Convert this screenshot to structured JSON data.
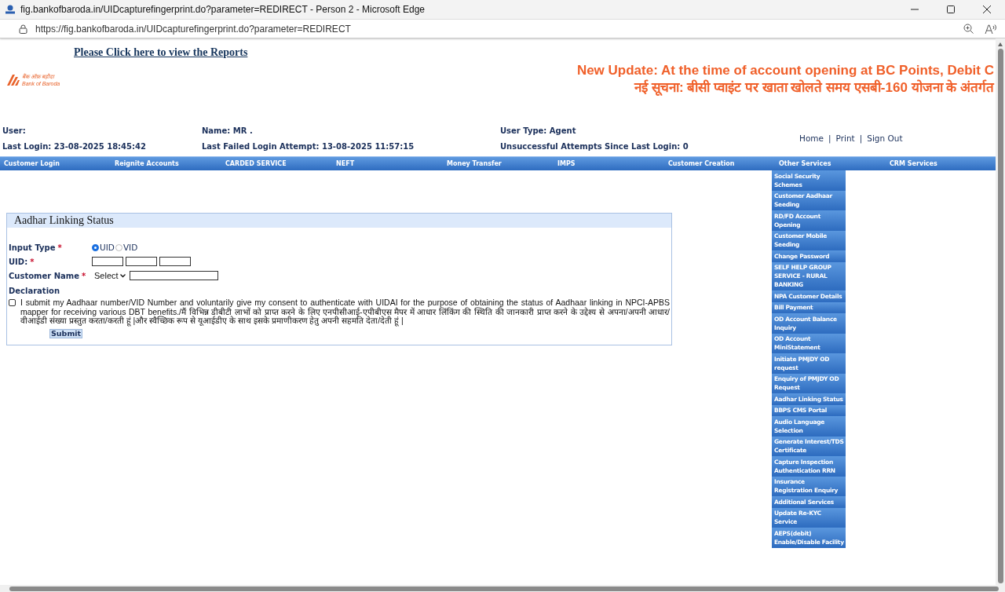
{
  "window": {
    "title": "fig.bankofbaroda.in/UIDcapturefingerprint.do?parameter=REDIRECT - Person 2 - Microsoft Edge"
  },
  "address_bar": {
    "url": "https://fig.bankofbaroda.in/UIDcapturefingerprint.do?parameter=REDIRECT"
  },
  "header": {
    "reports_link": "Please Click here to view the Reports",
    "logo_hindi": "बैंक ऑफ़ बड़ौदा",
    "logo_english": "Bank of Baroda",
    "news": [
      "New Update: At the time of account opening at BC Points, Debit C",
      "नई सूचना: बीसी प्वाइंट पर खाता खोलते समय एसबी-160 योजना के अंतर्गत"
    ]
  },
  "user_info": {
    "rows": [
      [
        "User:",
        "Name:  MR .",
        "User Type:  Agent"
      ],
      [
        "Last Login: 23-08-2025 18:45:42",
        "Last Failed Login Attempt:  13-08-2025 11:57:15",
        "Unsuccessful Attempts Since Last Login: 0"
      ]
    ],
    "links": [
      "Home",
      "Print",
      "Sign Out"
    ],
    "separator": "|"
  },
  "nav": [
    {
      "label": "Customer Login"
    },
    {
      "label": "Reignite Accounts"
    },
    {
      "label": "CARDED SERVICE"
    },
    {
      "label": "NEFT"
    },
    {
      "label": "Money Transfer"
    },
    {
      "label": "IMPS"
    },
    {
      "label": "Customer Creation"
    },
    {
      "label": "Other Services",
      "menu": [
        "Social Security Schemes",
        "Customer Aadhaar Seeding",
        "RD/FD Account Opening",
        "Customer Mobile Seeding",
        "Change Password",
        "SELF HELP GROUP SERVICE - RURAL BANKING",
        "NPA Customer Details",
        "Bill Payment",
        "OD Account Balance Inquiry",
        "OD Account MiniStatement",
        "Initiate PMJDY OD request",
        "Enquiry of PMJDY OD Request",
        "Aadhar Linking Status",
        "BBPS CMS Portal",
        "Audio Language Selection",
        "Generate Interest/TDS Certificate",
        "Capture Inspection Authentication RRN",
        "Insurance Registration Enquiry",
        "Additional Services",
        "Update Re-KYC Service",
        "AEPS(debit) Enable/Disable Facility"
      ]
    },
    {
      "label": "CRM Services"
    }
  ],
  "form": {
    "title": "Aadhar Linking Status",
    "required_mark": "*",
    "input_type": {
      "label": "Input Type",
      "options": [
        {
          "label": "UID",
          "selected": true
        },
        {
          "label": "VID",
          "selected": false
        }
      ]
    },
    "uid": {
      "label": "UID:"
    },
    "customer_name": {
      "label": "Customer Name",
      "select": "Select"
    },
    "declaration": {
      "heading": "Declaration",
      "checked": false,
      "text": "I submit my Aadhaar number/VID Number and voluntarily give my consent to authenticate with UIDAI for the purpose of obtaining the status of Aadhaar linking in NPCI-APBS mapper for receiving various DBT benefits./मैं विभिन्न डीबीटी लाभों को प्राप्त करने के लिए एनपीसीआई-एपीबीएस मैपर में आधार लिंकिंग की स्थिति की जानकारी प्राप्त करने के उद्देश्य से अपना/अपनी आधार/ वीआईडी संख्या प्रस्तुत करता/करती हूं |और स्वैच्छिक रूप से यूआईडीए के साथ इसके प्रमाणीकरण हेतु अपनी सहमति देता/देती हूं |"
    },
    "submit": "Submit"
  }
}
